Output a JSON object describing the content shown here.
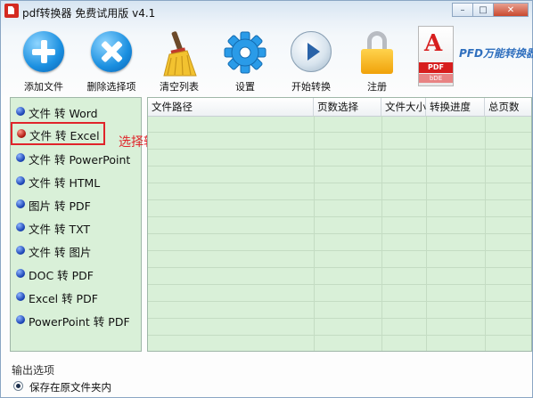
{
  "window": {
    "title": "pdf转换器 免费试用版 v4.1"
  },
  "toolbar": {
    "add_file": "添加文件",
    "remove_selected": "删除选择项",
    "clear_list": "清空列表",
    "settings": "设置",
    "start_convert": "开始转换",
    "register": "注册",
    "brand": "PFD万能转换器",
    "logo_band": "PDF",
    "logo_band2": "bDE"
  },
  "modes": {
    "items": [
      {
        "label": "文件 转 Word"
      },
      {
        "label": "文件 转 Excel",
        "selected": true
      },
      {
        "label": "文件 转 PowerPoint"
      },
      {
        "label": "文件 转 HTML"
      },
      {
        "label": "图片 转 PDF"
      },
      {
        "label": "文件 转 TXT"
      },
      {
        "label": "文件 转 图片"
      },
      {
        "label": "DOC 转 PDF"
      },
      {
        "label": "Excel 转 PDF"
      },
      {
        "label": "PowerPoint 转 PDF"
      }
    ]
  },
  "annotation": "选择转换模式",
  "table": {
    "columns": [
      "文件路径",
      "页数选择",
      "文件大小",
      "转换进度",
      "总页数"
    ]
  },
  "output": {
    "label": "输出选项",
    "option": "保存在原文件夹内"
  },
  "colors": {
    "panel_green": "#d9f0d8",
    "highlight_red": "#e0242a",
    "accent_blue": "#1a8fe0"
  }
}
